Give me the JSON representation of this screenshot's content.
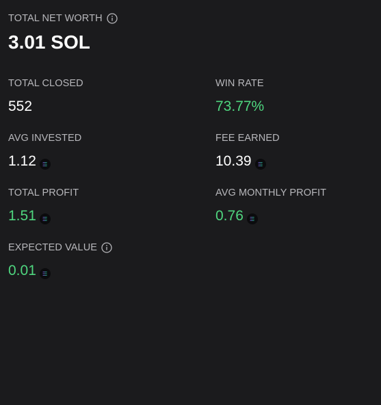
{
  "net_worth": {
    "label": "TOTAL NET WORTH",
    "value": "3.01 SOL",
    "info_icon": "info-circle-icon"
  },
  "stats": {
    "total_closed": {
      "label": "TOTAL CLOSED",
      "value": "552"
    },
    "win_rate": {
      "label": "WIN RATE",
      "value": "73.77%"
    },
    "avg_invested": {
      "label": "AVG INVESTED",
      "value": "1.12",
      "icon": "sol-token-icon"
    },
    "fee_earned": {
      "label": "FEE EARNED",
      "value": "10.39",
      "icon": "sol-token-icon"
    },
    "total_profit": {
      "label": "TOTAL PROFIT",
      "value": "1.51",
      "icon": "sol-token-icon"
    },
    "avg_monthly_profit": {
      "label": "AVG MONTHLY PROFIT",
      "value": "0.76",
      "icon": "sol-token-icon"
    },
    "expected_value": {
      "label": "EXPECTED VALUE",
      "value": "0.01",
      "icon": "sol-token-icon",
      "info_icon": "info-circle-icon"
    }
  },
  "colors": {
    "background": "#1b1b1d",
    "label": "#b7b7bb",
    "positive": "#4fd67f",
    "value": "#ffffff"
  }
}
